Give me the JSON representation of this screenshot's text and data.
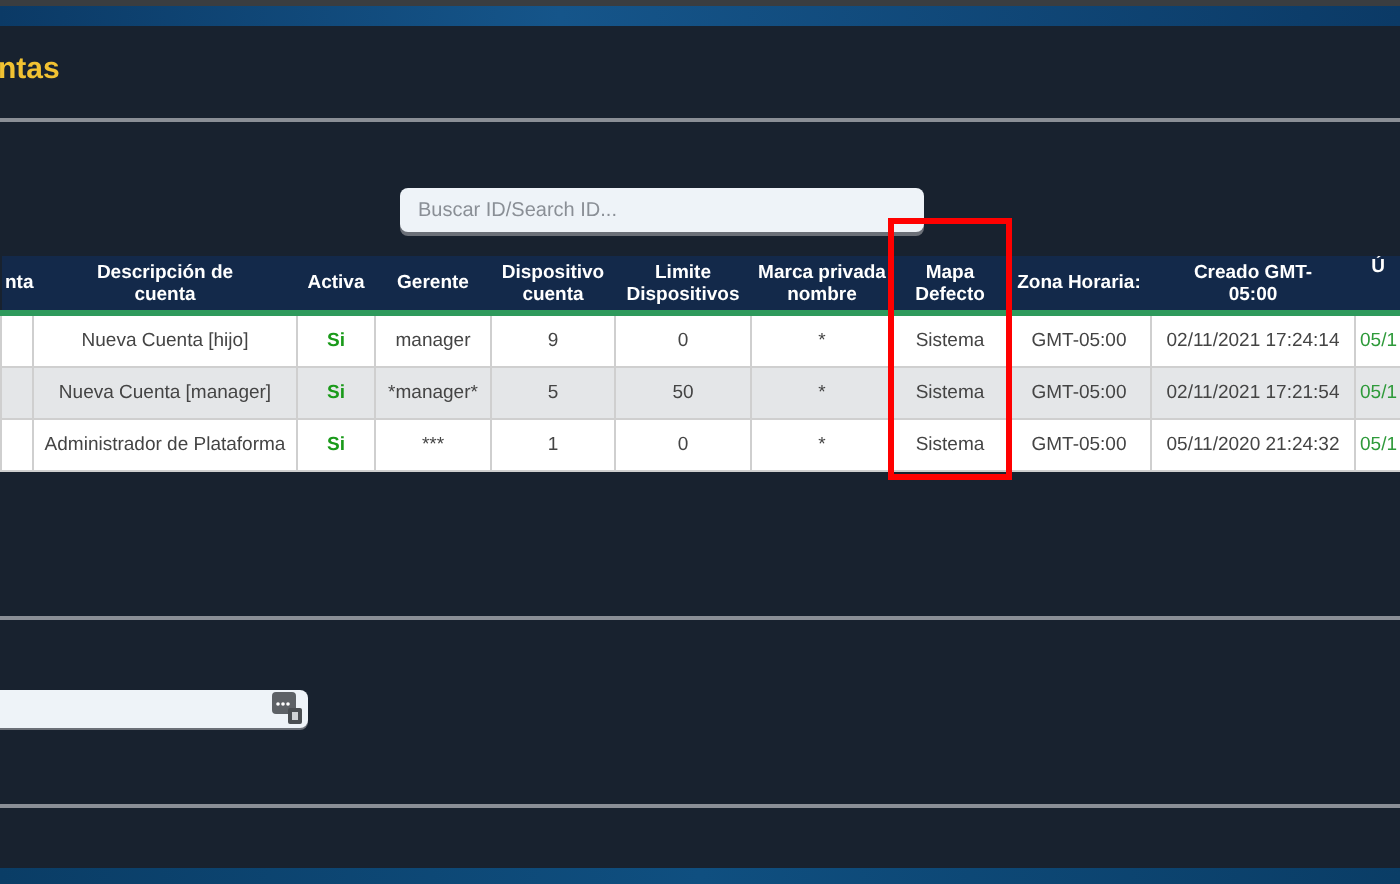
{
  "page": {
    "title": "ntas"
  },
  "search": {
    "placeholder": "Buscar ID/Search ID..."
  },
  "table": {
    "columns": [
      {
        "label": "nta",
        "kind": "blank",
        "highlighted": false
      },
      {
        "label": "Descripción de cuenta",
        "kind": "text",
        "highlighted": false
      },
      {
        "label": "Activa",
        "kind": "status",
        "highlighted": false
      },
      {
        "label": "Gerente",
        "kind": "text",
        "highlighted": false
      },
      {
        "label": "Dispositivo cuenta",
        "kind": "text",
        "highlighted": false
      },
      {
        "label": "Limite Dispositivos",
        "kind": "text",
        "highlighted": false
      },
      {
        "label": "Marca privada nombre",
        "kind": "text",
        "highlighted": false
      },
      {
        "label": "Mapa Defecto",
        "kind": "text",
        "highlighted": true
      },
      {
        "label": "Zona Horaria:",
        "kind": "text",
        "highlighted": false
      },
      {
        "label": "Creado GMT-05:00",
        "kind": "text",
        "highlighted": false
      },
      {
        "label": "Ú",
        "kind": "recent",
        "highlighted": false
      }
    ],
    "rows": [
      {
        "cells": [
          "",
          "Nueva Cuenta [hijo]",
          "Si",
          "manager",
          "9",
          "0",
          "*",
          "Sistema",
          "GMT-05:00",
          "02/11/2021 17:24:14",
          "05/1"
        ]
      },
      {
        "cells": [
          "",
          "Nueva Cuenta [manager]",
          "Si",
          "*manager*",
          "5",
          "50",
          "*",
          "Sistema",
          "GMT-05:00",
          "02/11/2021 17:21:54",
          "05/1"
        ]
      },
      {
        "cells": [
          "",
          "Administrador de Plataforma",
          "Si",
          "***",
          "1",
          "0",
          "*",
          "Sistema",
          "GMT-05:00",
          "05/11/2020 21:24:32",
          "05/1"
        ]
      }
    ]
  }
}
